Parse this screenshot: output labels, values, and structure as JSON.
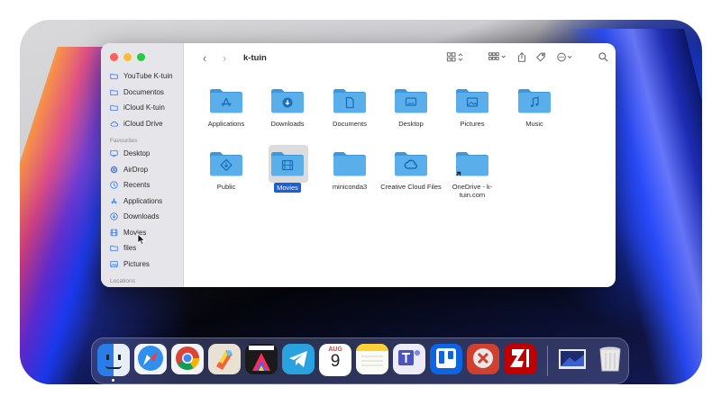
{
  "window": {
    "title": "k-tuin",
    "nav": {
      "back": "‹",
      "forward": "›"
    }
  },
  "sidebar": {
    "items_top": [
      {
        "label": "YouTube K-tuin",
        "icon": "folder-icon"
      },
      {
        "label": "Documentos",
        "icon": "folder-icon"
      },
      {
        "label": "iCloud K-tuin",
        "icon": "folder-icon"
      },
      {
        "label": "iCloud Drive",
        "icon": "cloud-icon"
      }
    ],
    "favorites_heading": "Favourites",
    "favorites": [
      {
        "label": "Desktop",
        "icon": "desktop-icon"
      },
      {
        "label": "AirDrop",
        "icon": "airdrop-icon"
      },
      {
        "label": "Recents",
        "icon": "clock-icon"
      },
      {
        "label": "Applications",
        "icon": "applications-icon"
      },
      {
        "label": "Downloads",
        "icon": "download-icon"
      },
      {
        "label": "Movies",
        "icon": "film-icon"
      },
      {
        "label": "files",
        "icon": "folder-icon"
      },
      {
        "label": "Pictures",
        "icon": "photo-icon"
      }
    ],
    "locations_heading": "Locations"
  },
  "files": [
    {
      "label": "Applications",
      "glyph": "applications-icon",
      "selected": false
    },
    {
      "label": "Downloads",
      "glyph": "download-icon",
      "selected": false
    },
    {
      "label": "Documents",
      "glyph": "document-icon",
      "selected": false
    },
    {
      "label": "Desktop",
      "glyph": "desktop-icon",
      "selected": false
    },
    {
      "label": "Pictures",
      "glyph": "photo-icon",
      "selected": false
    },
    {
      "label": "Music",
      "glyph": "music-icon",
      "selected": false
    },
    {
      "label": "Public",
      "glyph": "public-icon",
      "selected": false
    },
    {
      "label": "Movies",
      "glyph": "film-icon",
      "selected": true
    },
    {
      "label": "miniconda3",
      "glyph": "",
      "selected": false
    },
    {
      "label": "Creative Cloud Files",
      "glyph": "creative-cloud-icon",
      "selected": false
    },
    {
      "label": "OneDrive - k-tuin.com",
      "glyph": "alias-icon",
      "selected": false
    }
  ],
  "dock": {
    "apps": [
      {
        "name": "finder",
        "icon": "finder-icon"
      },
      {
        "name": "safari",
        "icon": "safari-icon"
      },
      {
        "name": "chrome",
        "icon": "chrome-icon"
      },
      {
        "name": "pixelmator",
        "icon": "pixelmator-icon"
      },
      {
        "name": "final-cut-pro",
        "icon": "final-cut-icon"
      },
      {
        "name": "telegram",
        "icon": "telegram-icon"
      },
      {
        "name": "calendar",
        "icon": "calendar-icon",
        "month": "AUG",
        "day": "9"
      },
      {
        "name": "notes",
        "icon": "notes-icon"
      },
      {
        "name": "teams",
        "icon": "teams-icon"
      },
      {
        "name": "trello",
        "icon": "trello-icon"
      },
      {
        "name": "remote-desktop",
        "icon": "remote-desktop-icon"
      },
      {
        "name": "filezilla",
        "icon": "filezilla-icon"
      },
      {
        "name": "downloads-stack",
        "icon": "stack-icon"
      },
      {
        "name": "trash",
        "icon": "trash-icon"
      }
    ]
  },
  "colors": {
    "accent": "#3478f6",
    "folder": "#5aaeea",
    "selection": "#1a5fd6"
  }
}
